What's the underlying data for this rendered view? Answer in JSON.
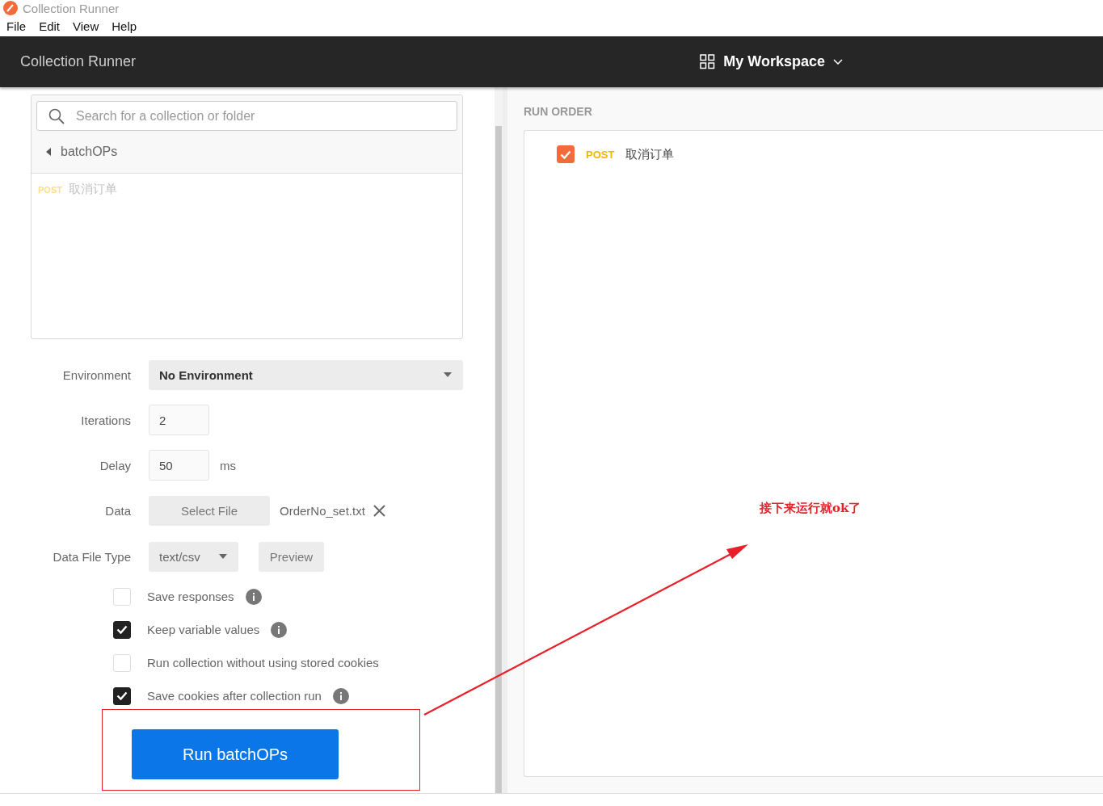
{
  "app": {
    "title": "Collection Runner"
  },
  "menu": [
    "File",
    "Edit",
    "View",
    "Help"
  ],
  "header": {
    "title": "Collection Runner",
    "workspace": "My Workspace"
  },
  "collections": {
    "search": {
      "placeholder": "Search for a collection or folder"
    },
    "folder": {
      "name": "batchOPs"
    },
    "requests": [
      {
        "method": "POST",
        "name": "取消订单"
      }
    ]
  },
  "settings": {
    "environment": {
      "label": "Environment",
      "value": "No Environment"
    },
    "iterations": {
      "label": "Iterations",
      "value": "2"
    },
    "delay": {
      "label": "Delay",
      "value": "50",
      "unit": "ms"
    },
    "data": {
      "label": "Data",
      "button": "Select File",
      "file": "OrderNo_set.txt"
    },
    "data_file_type": {
      "label": "Data File Type",
      "value": "text/csv",
      "button": "Preview"
    },
    "options": [
      {
        "label": "Save responses",
        "checked": false,
        "info": true
      },
      {
        "label": "Keep variable values",
        "checked": true,
        "info": true
      },
      {
        "label": "Run collection without using stored cookies",
        "checked": false,
        "info": false
      },
      {
        "label": "Save cookies after collection run",
        "checked": true,
        "info": true
      }
    ],
    "run_button": "Run batchOPs"
  },
  "run_order": {
    "title": "RUN ORDER",
    "items": [
      {
        "checked": true,
        "method": "POST",
        "name": "取消订单"
      }
    ]
  },
  "annotation": {
    "text": "接下来运行就ok了"
  }
}
